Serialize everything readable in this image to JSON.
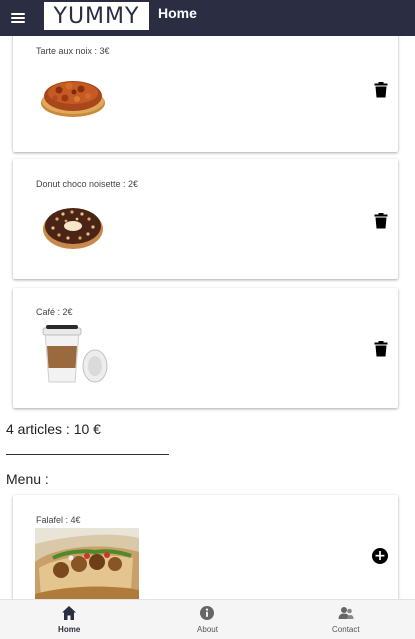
{
  "header": {
    "logo_text": "YUMMY",
    "title": "Home"
  },
  "cart": {
    "items": [
      {
        "label": "Tarte aux noix : 3€",
        "icon": "walnut-tart-image"
      },
      {
        "label": "Donut choco noisette : 2€",
        "icon": "donut-image"
      },
      {
        "label": "Café : 2€",
        "icon": "coffee-cup-image"
      }
    ],
    "total": "4 articles : 10 €"
  },
  "menu": {
    "heading": "Menu :",
    "items": [
      {
        "label": "Falafel : 4€",
        "icon": "falafel-image"
      }
    ]
  },
  "bottom_nav": {
    "items": [
      {
        "label": "Home",
        "icon": "home-icon",
        "active": true
      },
      {
        "label": "About",
        "icon": "info-icon",
        "active": false
      },
      {
        "label": "Contact",
        "icon": "contact-icon",
        "active": false
      }
    ]
  },
  "colors": {
    "app_bar": "#2b2d42",
    "background": "#ffffff",
    "nav_background": "#f5f5f5"
  }
}
